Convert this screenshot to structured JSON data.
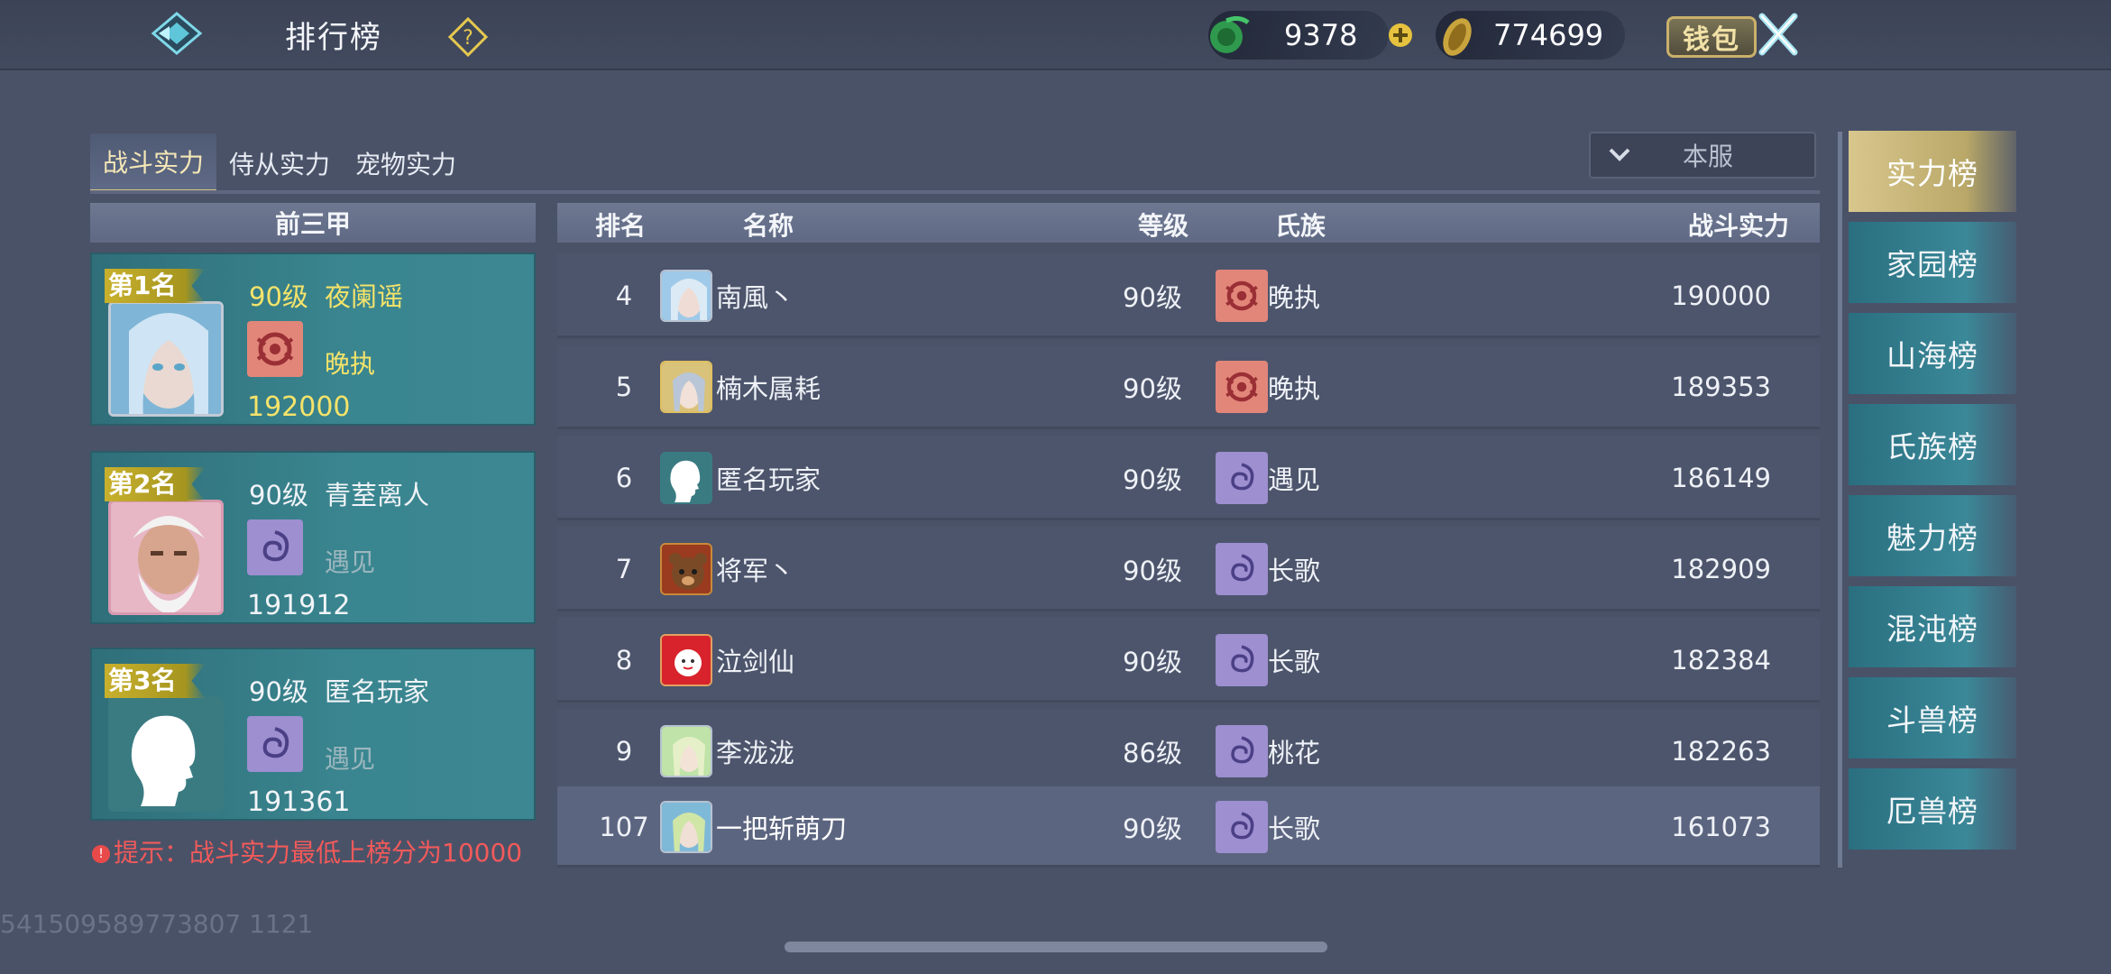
{
  "header": {
    "title": "排行榜",
    "jade": "9378",
    "gold": "774699",
    "wallet_label": "钱包"
  },
  "tabs": [
    "战斗实力",
    "侍从实力",
    "宠物实力"
  ],
  "server_select": "本服",
  "top3": {
    "header": "前三甲",
    "entries": [
      {
        "rank": "第1名",
        "level": "90级",
        "name": "夜阑谣",
        "clan": "晚执",
        "power": "192000"
      },
      {
        "rank": "第2名",
        "level": "90级",
        "name": "青荎离人",
        "clan": "遇见",
        "power": "191912"
      },
      {
        "rank": "第3名",
        "level": "90级",
        "name": "匿名玩家",
        "clan": "遇见",
        "power": "191361"
      }
    ]
  },
  "tip": "提示：战斗实力最低上榜分为10000",
  "table": {
    "columns": {
      "rank": "排名",
      "name": "名称",
      "level": "等级",
      "clan": "氏族",
      "power": "战斗实力"
    },
    "rows": [
      {
        "rank": "4",
        "name": "南風丶",
        "level": "90级",
        "clan": "晚执",
        "power": "190000"
      },
      {
        "rank": "5",
        "name": "楠木属耗",
        "level": "90级",
        "clan": "晚执",
        "power": "189353"
      },
      {
        "rank": "6",
        "name": "匿名玩家",
        "level": "90级",
        "clan": "遇见",
        "power": "186149"
      },
      {
        "rank": "7",
        "name": "将军丶",
        "level": "90级",
        "clan": "长歌",
        "power": "182909"
      },
      {
        "rank": "8",
        "name": "泣剑仙",
        "level": "90级",
        "clan": "长歌",
        "power": "182384"
      },
      {
        "rank": "9",
        "name": "李泷泷",
        "level": "86级",
        "clan": "桃花",
        "power": "182263"
      }
    ],
    "my_row": {
      "rank": "107",
      "name": "一把斩萌刀",
      "level": "90级",
      "clan": "长歌",
      "power": "161073"
    }
  },
  "categories": [
    "实力榜",
    "家园榜",
    "山海榜",
    "氏族榜",
    "魅力榜",
    "混沌榜",
    "斗兽榜",
    "厄兽榜"
  ],
  "footer_id": "541509589773807 1121"
}
